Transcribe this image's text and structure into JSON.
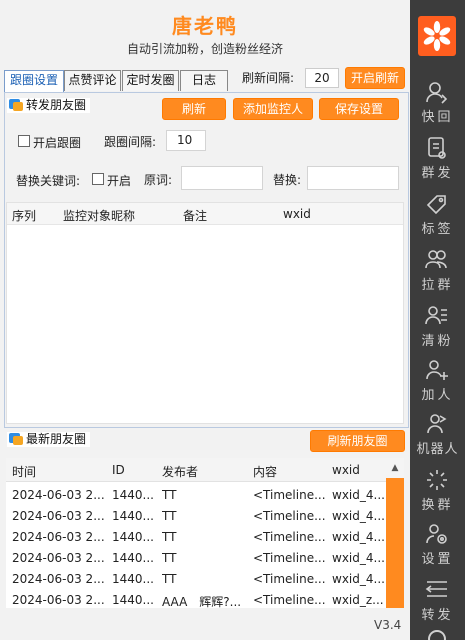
{
  "header": {
    "title": "唐老鸭",
    "subtitle": "自动引流加粉，创造粉丝经济"
  },
  "tabs": [
    {
      "label": "跟圈设置",
      "active": true
    },
    {
      "label": "点赞评论",
      "active": false
    },
    {
      "label": "定时发圈",
      "active": false
    },
    {
      "label": "日志",
      "active": false
    }
  ],
  "toolbar": {
    "refresh_interval_label": "刷新间隔:",
    "refresh_interval_value": "20",
    "start_refresh_label": "开启刷新"
  },
  "forward_section": {
    "title": "转发朋友圈",
    "refresh_label": "刷新",
    "add_monitor_label": "添加监控人",
    "save_settings_label": "保存设置",
    "enable_follow_label": "开启跟圈",
    "enable_follow_checked": false,
    "follow_interval_label": "跟圈间隔:",
    "follow_interval_value": "10",
    "replace_keyword_label": "替换关键词:",
    "replace_enable_label": "开启",
    "replace_enable_checked": false,
    "original_word_label": "原词:",
    "original_word_value": "",
    "replace_with_label": "替换:",
    "replace_with_value": ""
  },
  "monitor_table": {
    "columns": [
      "序列",
      "监控对象昵称",
      "备注",
      "wxid"
    ],
    "rows": []
  },
  "moments_section": {
    "title": "最新朋友圈",
    "refresh_label": "刷新朋友圈",
    "columns": [
      "时间",
      "ID",
      "发布者",
      "内容",
      "wxid"
    ],
    "rows": [
      {
        "time": "2024-06-03 2...",
        "id": "1440...",
        "publisher": "TT",
        "content": "<Timeline...",
        "wxid": "wxid_4..."
      },
      {
        "time": "2024-06-03 2...",
        "id": "1440...",
        "publisher": "TT",
        "content": "<Timeline...",
        "wxid": "wxid_4..."
      },
      {
        "time": "2024-06-03 2...",
        "id": "1440...",
        "publisher": "TT",
        "content": "<Timeline...",
        "wxid": "wxid_4..."
      },
      {
        "time": "2024-06-03 2...",
        "id": "1440...",
        "publisher": "TT",
        "content": "<Timeline...",
        "wxid": "wxid_4..."
      },
      {
        "time": "2024-06-03 2...",
        "id": "1440...",
        "publisher": "TT",
        "content": "<Timeline...",
        "wxid": "wxid_4..."
      },
      {
        "time": "2024-06-03 2...",
        "id": "1440...",
        "publisher": "AAA　辉辉?...",
        "content": "<Timeline...",
        "wxid": "wxid_z..."
      }
    ]
  },
  "version": "V3.4",
  "sidebar": {
    "items": [
      {
        "label": "快回",
        "icon": "quick-reply-icon"
      },
      {
        "label": "群发",
        "icon": "mass-send-icon"
      },
      {
        "label": "标签",
        "icon": "tag-icon"
      },
      {
        "label": "拉群",
        "icon": "pull-group-icon"
      },
      {
        "label": "清粉",
        "icon": "clean-fans-icon"
      },
      {
        "label": "加人",
        "icon": "add-person-icon"
      },
      {
        "label": "机器人",
        "icon": "robot-icon"
      },
      {
        "label": "换群",
        "icon": "switch-group-icon"
      },
      {
        "label": "设置",
        "icon": "settings-icon"
      },
      {
        "label": "转发",
        "icon": "forward-icon"
      }
    ]
  },
  "colors": {
    "accent": "#ff8a1f",
    "sidebar_bg": "#3c3c3c",
    "logo_bg": "#ff5e1f"
  }
}
